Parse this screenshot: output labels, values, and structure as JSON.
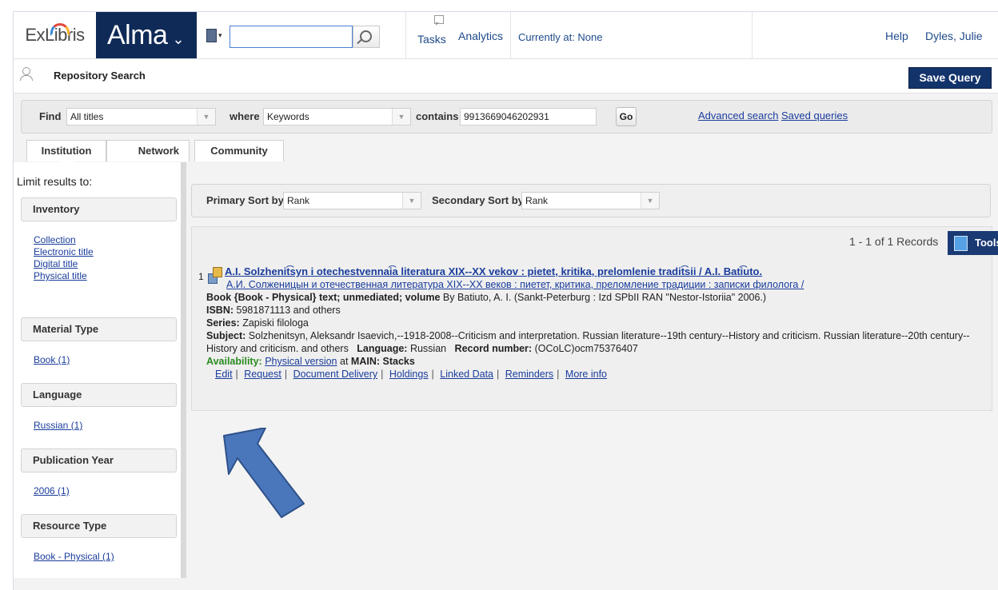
{
  "header": {
    "logo_exlibris": "ExLibris",
    "logo_alma": "Alma",
    "logo_caret": "⌄",
    "search_placeholder": "",
    "tasks": "Tasks",
    "analytics": "Analytics",
    "currently_at": "Currently at: None",
    "help": "Help",
    "user": "Dyles, Julie"
  },
  "page": {
    "title": "Repository Search",
    "save_query": "Save Query"
  },
  "find_bar": {
    "find_label": "Find",
    "find_value": "All titles",
    "where_label": "where",
    "where_value": "Keywords",
    "contains_label": "contains",
    "contains_value": "9913669046202931",
    "go": "Go",
    "advanced_search": "Advanced search",
    "saved_queries": "Saved queries"
  },
  "tabs": [
    {
      "label": "Institution"
    },
    {
      "label": "Network"
    },
    {
      "label": "Community"
    }
  ],
  "sidebar": {
    "limit_label": "Limit results to:",
    "inventory": {
      "title": "Inventory",
      "items": [
        "Collection",
        "Electronic title",
        "Digital title",
        "Physical title"
      ]
    },
    "material_type": {
      "title": "Material Type",
      "items": [
        "Book (1)"
      ]
    },
    "language": {
      "title": "Language",
      "items": [
        "Russian (1)"
      ]
    },
    "publication_year": {
      "title": "Publication Year",
      "items": [
        "2006 (1)"
      ]
    },
    "resource_type": {
      "title": "Resource Type",
      "items": [
        "Book - Physical (1)"
      ]
    }
  },
  "sort": {
    "primary_label": "Primary Sort by",
    "primary_value": "Rank",
    "secondary_label": "Secondary Sort by",
    "secondary_value": "Rank"
  },
  "results": {
    "count": "1 - 1 of 1 Records",
    "tools": "Tools",
    "record": {
      "number": "1",
      "title": "A.I. Solzhenit͡syn i otechestvennai͡a literatura XIX--XX vekov : pietet, kritika, prelomlenie tradit͡sii / A.I. Bati͡uto.",
      "title_cyrillic": "А.И. Солженицын и отечественная литература XIX--XX веков : пиетет, критика, преломление традиции : записки филолога /",
      "format_line": "Book {Book - Physical} text; unmediated; volume",
      "by_line": "By Batiuto, A. I. (Sankt-Peterburg : Izd SPbII RAN \"Nestor-Istoriia\" 2006.)",
      "isbn_label": "ISBN:",
      "isbn_value": "5981871113 and others",
      "series_label": "Series:",
      "series_value": "Zapiski filologa",
      "subject_label": "Subject:",
      "subject_value": "Solzhenitsyn, Aleksandr Isaevich,--1918-2008--Criticism and interpretation. Russian literature--19th century--History and criticism. Russian literature--20th century--History and criticism. and others",
      "language_label": "Language:",
      "language_value": "Russian",
      "record_number_label": "Record number:",
      "record_number_value": "(OCoLC)ocm75376407",
      "availability_label": "Availability:",
      "availability_link": "Physical version",
      "availability_at": "at",
      "availability_location": "MAIN: Stacks",
      "actions": [
        "Edit",
        "Request",
        "Document Delivery",
        "Holdings",
        "Linked Data",
        "Reminders",
        "More info"
      ]
    }
  },
  "colors": {
    "brand_navy": "#0f2a57",
    "link": "#1a3d9c",
    "availability_green": "#2a8a1f",
    "arrow_fill": "#4a77bb"
  },
  "icons": [
    "search-type-icon",
    "magnifier-icon",
    "tasks-icon",
    "repository-icon",
    "tools-icon",
    "record-type-icon",
    "up-arrow-annotation"
  ]
}
